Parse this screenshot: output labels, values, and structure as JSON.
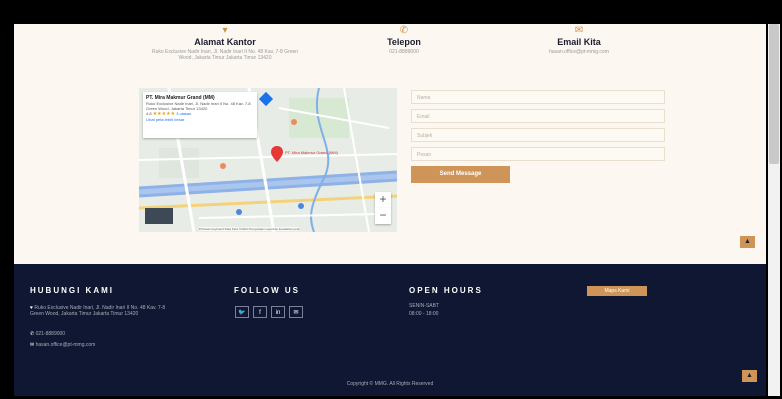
{
  "contact": {
    "office": {
      "title": "Alamat Kantor",
      "text": "Ruko Exclusive Nadir Inari, Jl. Nadir Inari II No. 48 Kav. 7-8 Green Wood, Jakarta Timur Jakarta Timur 13420"
    },
    "phone": {
      "title": "Telepon",
      "text": "021-8889000"
    },
    "email": {
      "title": "Email Kita",
      "text": "hasan.office@pt-mmg.com"
    }
  },
  "map": {
    "place_name": "PT. Mira Makmur Grand (MM)",
    "place_addr": "Ruko Exclusive Nadir Inari, Jl. Nadir Inari II No. 48 Kav. 7-8 Green Wood, Jakarta Timur 13420",
    "rating": "4.8",
    "stars": "★★★★★",
    "reviews": "3 ulasan",
    "larger_map": "Lihat peta lebih besar",
    "directions": "Rute",
    "pin_label": "PT. Mira Makmur Grand (MM)",
    "zoom_in": "+",
    "zoom_out": "−",
    "attribution": "Pintasan keyboard   Data Peta ©2024   Persyaratan   Laporkan kesalahan peta"
  },
  "form": {
    "name_placeholder": "Nama",
    "email_placeholder": "Email",
    "subject_placeholder": "Subjek",
    "message_placeholder": "Pesan",
    "send_label": "Send Message"
  },
  "footer": {
    "contact_heading": "HUBUNGI KAMI",
    "address": "Ruko Exclusive Nadir Inari, Jl. Nadir Inari II No. 48 Kav. 7-8 Green Wood, Jakarta Timur Jakarta Timur 13420",
    "phone": "021-8889000",
    "email": "hasan.office@pt-mmg.com",
    "follow_heading": "FOLLOW US",
    "social": [
      "twitter",
      "facebook",
      "linkedin",
      "email"
    ],
    "hours_heading": "OPEN HOURS",
    "hours_days": "SENIN-SABT",
    "hours_time": "08:00 - 18:00",
    "map_button": "Maps Kami",
    "copyright": "Copyright © MMG. All Rights Reserved"
  },
  "to_top": "▲",
  "accent_color": "#cf9558",
  "footer_color": "#0f1732"
}
